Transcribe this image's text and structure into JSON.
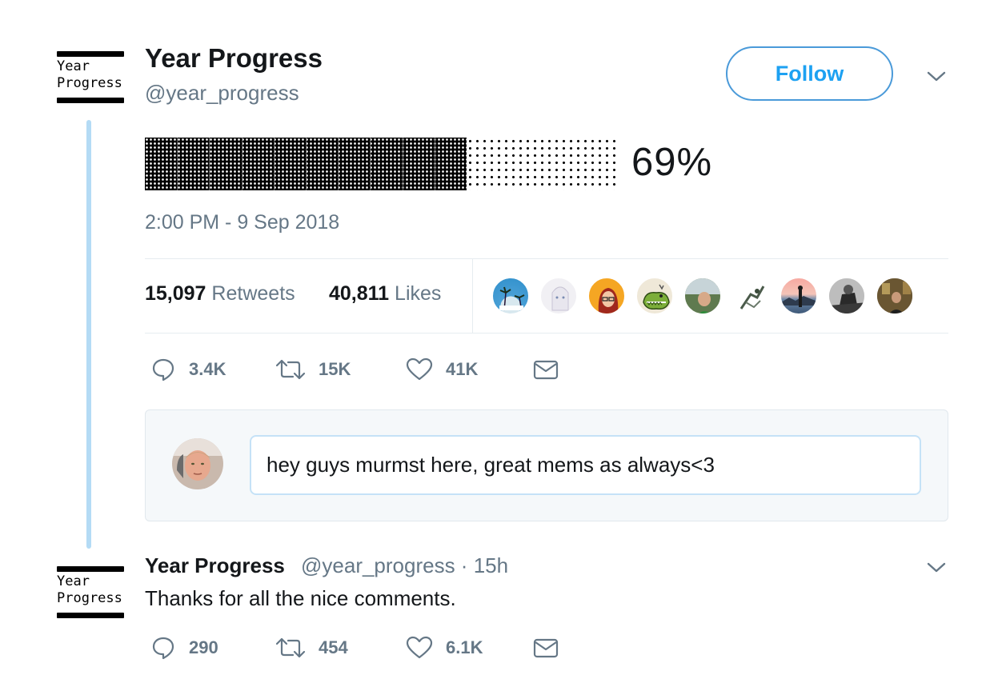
{
  "tweet": {
    "logo": {
      "line1": "Year",
      "line2": "Progress"
    },
    "display_name": "Year Progress",
    "handle": "@year_progress",
    "follow_label": "Follow",
    "progress": {
      "fraction": 0.69,
      "label": "69%"
    },
    "timestamp": "2:00 PM - 9 Sep 2018",
    "stats": {
      "retweets_count": "15,097",
      "retweets_label": "Retweets",
      "likes_count": "40,811",
      "likes_label": "Likes"
    },
    "liker_avatars": [
      "avatar-palm-beach",
      "avatar-anime-white",
      "avatar-red-hair-girl",
      "avatar-green-frog",
      "avatar-man-outdoors",
      "avatar-sketch-figure",
      "avatar-sunset-lake",
      "avatar-bw-figure",
      "avatar-man-room"
    ],
    "actions": {
      "replies": "3.4K",
      "retweets": "15K",
      "likes": "41K"
    }
  },
  "reply_composer": {
    "text": "hey guys murmst here, great mems as always<3"
  },
  "reply": {
    "logo": {
      "line1": "Year",
      "line2": "Progress"
    },
    "display_name": "Year Progress",
    "meta": "@year_progress · 15h",
    "text": "Thanks for all the nice comments.",
    "actions": {
      "replies": "290",
      "retweets": "454",
      "likes": "6.1K"
    }
  },
  "colors": {
    "link_blue": "#1da1f2",
    "muted": "#657786",
    "thread_line": "#b4dbf5"
  }
}
